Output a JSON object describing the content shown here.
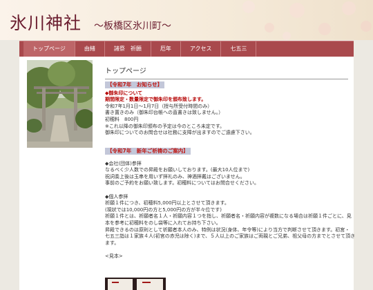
{
  "header": {
    "title": "氷川神社",
    "subtitle": "〜板橋区氷川町〜"
  },
  "nav": {
    "items": [
      {
        "label": "トップページ"
      },
      {
        "label": "由緒"
      },
      {
        "label": "諸祭　祈願"
      },
      {
        "label": "厄年"
      },
      {
        "label": "アクセス"
      },
      {
        "label": "七五三"
      }
    ]
  },
  "main": {
    "page_title": "トップページ",
    "notice": {
      "heading": "【令和7年　お知らせ】",
      "lines": [
        "◆御朱印について",
        "期間限定・数量限定で御朱印を頒布致します。",
        "令和7年1月1日〜1月7日（授与所受付時間のみ）",
        "書き置きのみ（御朱印台帳への直書きは致しません。）",
        "初穂料　800円",
        "※これ以降の御朱印頒布の予定は今のところ未定です。",
        "御朱印についてのお問合せは社務に支障が出ますのでご遠慮下さい。"
      ]
    },
    "prayer": {
      "heading": "【令和7年　新年ご祈祷のご案内】",
      "lines": [
        "◆会社(団体)参拝",
        "なるべく少人数での昇殿をお願いしております。(最大10人位まで)",
        "祝詞奏上後は玉串を用いず拝礼のみ、神酒拝戴はございません。",
        "事前のご予約をお願い致します。初穂料についてはお問合せください。",
        "",
        "◆個人参拝",
        "祈願１件につき、初穂料5,000円以上とさせて頂きます。",
        "(現状では10,000円の方と5,000円の方が半々位です)",
        "祈願１件とは、祈願者名１人・祈願内容１つを指し、祈願者名・祈願内容が複数になる場合は祈願１件ごとに、見",
        "本を参考に初穂料をのし袋等に入れてお持ち下さい。",
        "昇殿できるのは原則として祈願者本人のみ、特例は状況(身体、年令等)により当方で判断させて頂きます。初宮・",
        "七五三詣は１家族４人(初宮の赤児は除く)まで、５人以上のご家族はご両親とご兄弟、祖父母の方までとさせて頂き",
        "ます。",
        "",
        "<見本>"
      ]
    }
  },
  "colors": {
    "title": "#6b1d2f",
    "nav_bg": "#a9494d",
    "notice_red": "#b40000",
    "heading_bg": "#c3c7d9"
  }
}
